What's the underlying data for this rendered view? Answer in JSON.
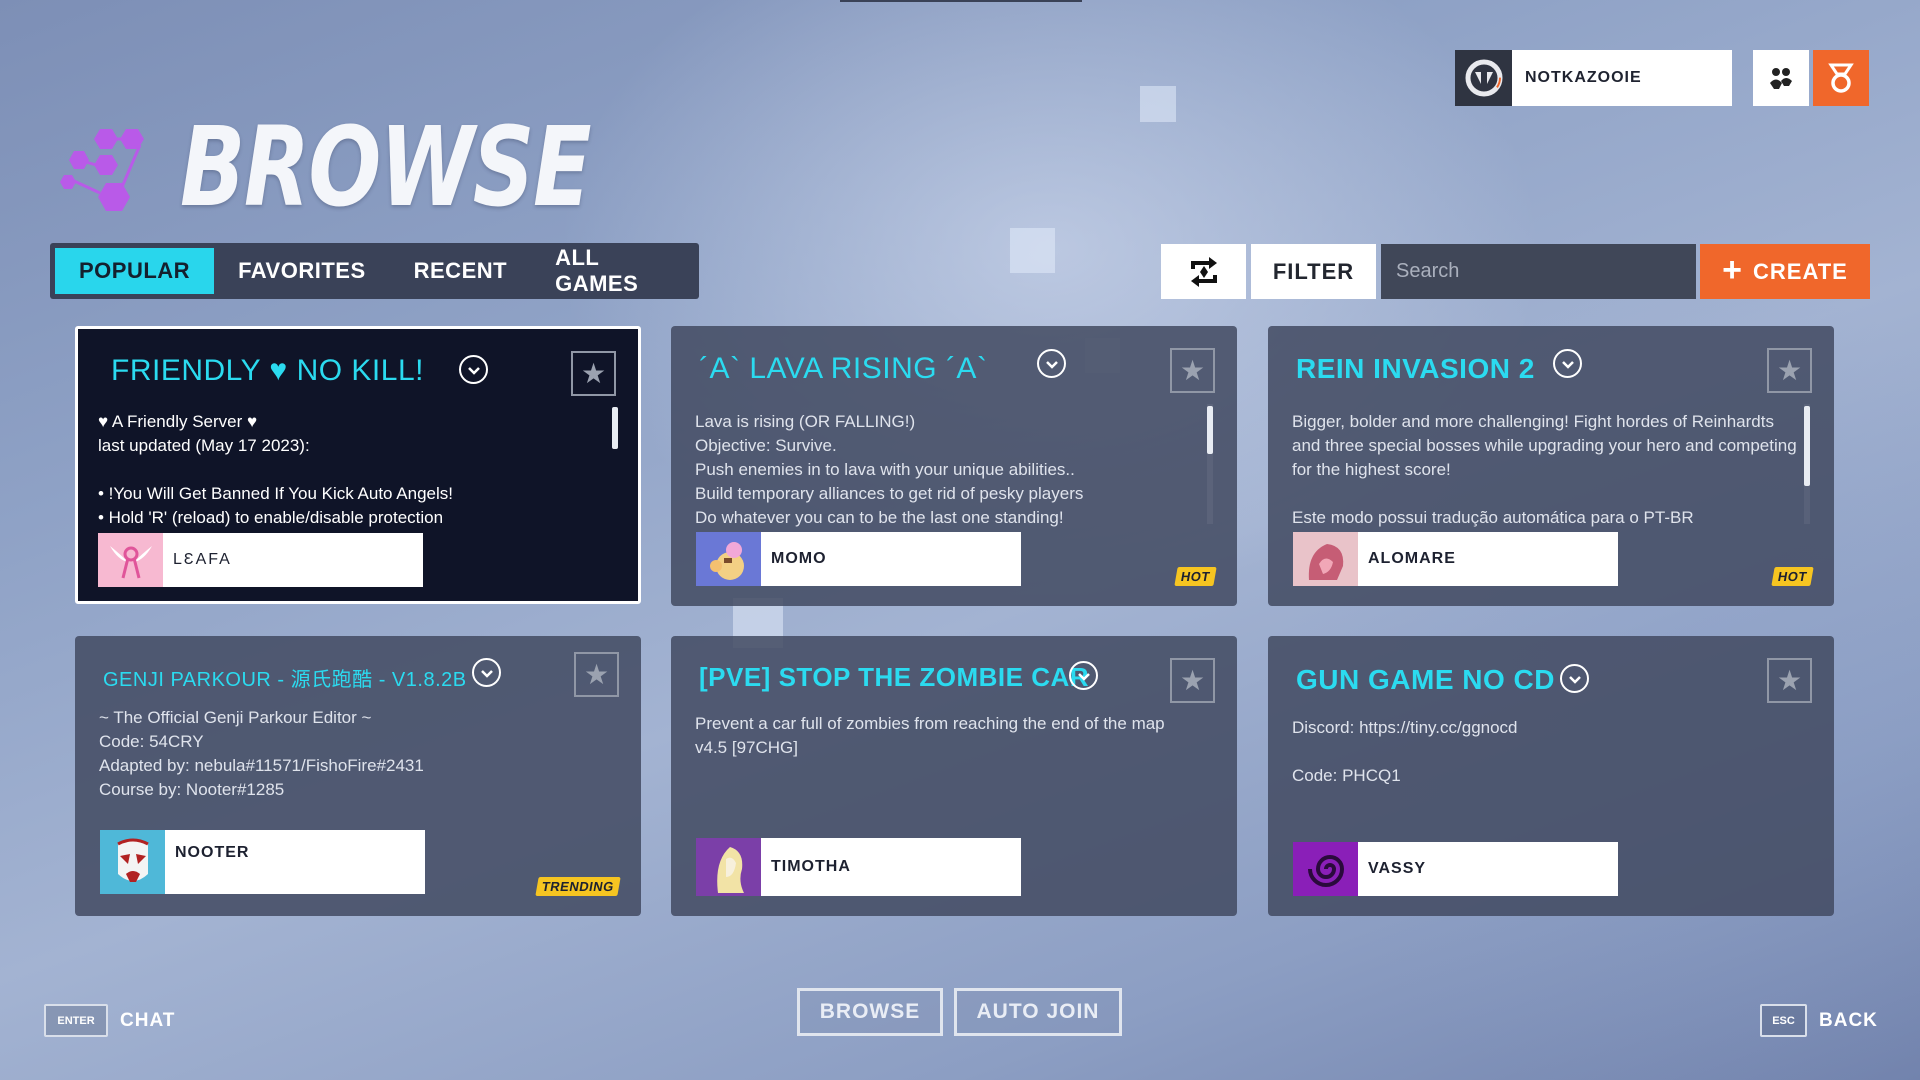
{
  "header": {
    "title": "BROWSE",
    "username": "NOTKAZOOIE"
  },
  "tabs": [
    {
      "label": "POPULAR",
      "active": true
    },
    {
      "label": "FAVORITES",
      "active": false
    },
    {
      "label": "RECENT",
      "active": false
    },
    {
      "label": "ALL GAMES",
      "active": false
    }
  ],
  "toolbar": {
    "filter_label": "FILTER",
    "search_placeholder": "Search",
    "create_label": "CREATE"
  },
  "cards": [
    {
      "title": "FRIENDLY ♥ NO KILL!",
      "description": "♥ A Friendly Server ♥\nlast updated (May 17 2023):\n\n• !You Will Get Banned If You Kick Auto Angels!\n• Hold 'R' (reload) to enable/disable protection",
      "author": "LƐAFA",
      "tag": "",
      "selected": true
    },
    {
      "title": "´A` LAVA RISING ´A`",
      "description": "Lava is rising (OR FALLING!)\nObjective: Survive.\nPush enemies in to lava with your unique abilities..\nBuild temporary alliances to get rid of pesky players\nDo whatever you can to be the last one standing!",
      "author": "MOMO",
      "tag": "HOT",
      "selected": false
    },
    {
      "title": "REIN INVASION 2",
      "description": "Bigger, bolder and more challenging! Fight hordes of Reinhardts and three special bosses while upgrading your hero and competing for the highest score!\n\nEste modo possui tradução automática para o PT-BR",
      "author": "ALOMARE",
      "tag": "HOT",
      "selected": false
    },
    {
      "title": "GENJI PARKOUR - 源氏跑酷 - V1.8.2B",
      "description": "~ The Official Genji Parkour Editor ~\nCode: 54CRY\nAdapted by: nebula#11571/FishoFire#2431\nCourse by: Nooter#1285",
      "author": "NOOTER",
      "tag": "TRENDING",
      "selected": false
    },
    {
      "title": "[PVE] STOP THE ZOMBIE CAR",
      "description": "Prevent a car full of zombies from reaching the end of the map\nv4.5 [97CHG]",
      "author": "TIMOTHA",
      "tag": "",
      "selected": false
    },
    {
      "title": "GUN GAME NO CD",
      "description": "Discord: https://tiny.cc/ggnocd\n\nCode: PHCQ1",
      "author": "VASSY",
      "tag": "",
      "selected": false
    }
  ],
  "footer": {
    "enter_key": "ENTER",
    "chat_label": "CHAT",
    "browse_label": "BROWSE",
    "auto_join_label": "AUTO JOIN",
    "esc_key": "ESC",
    "back_label": "BACK"
  },
  "colors": {
    "accent_cyan": "#2bdbf0",
    "accent_orange": "#f0672b",
    "title_icon": "#b95ae8",
    "tag_yellow": "#f6c521"
  },
  "icons": {
    "user_logo": "overwatch-logo-icon",
    "social": "social-icon",
    "reward": "reward-medal-icon",
    "refresh": "swap-refresh-icon",
    "star": "star-icon",
    "chevron": "chevron-down-icon"
  }
}
